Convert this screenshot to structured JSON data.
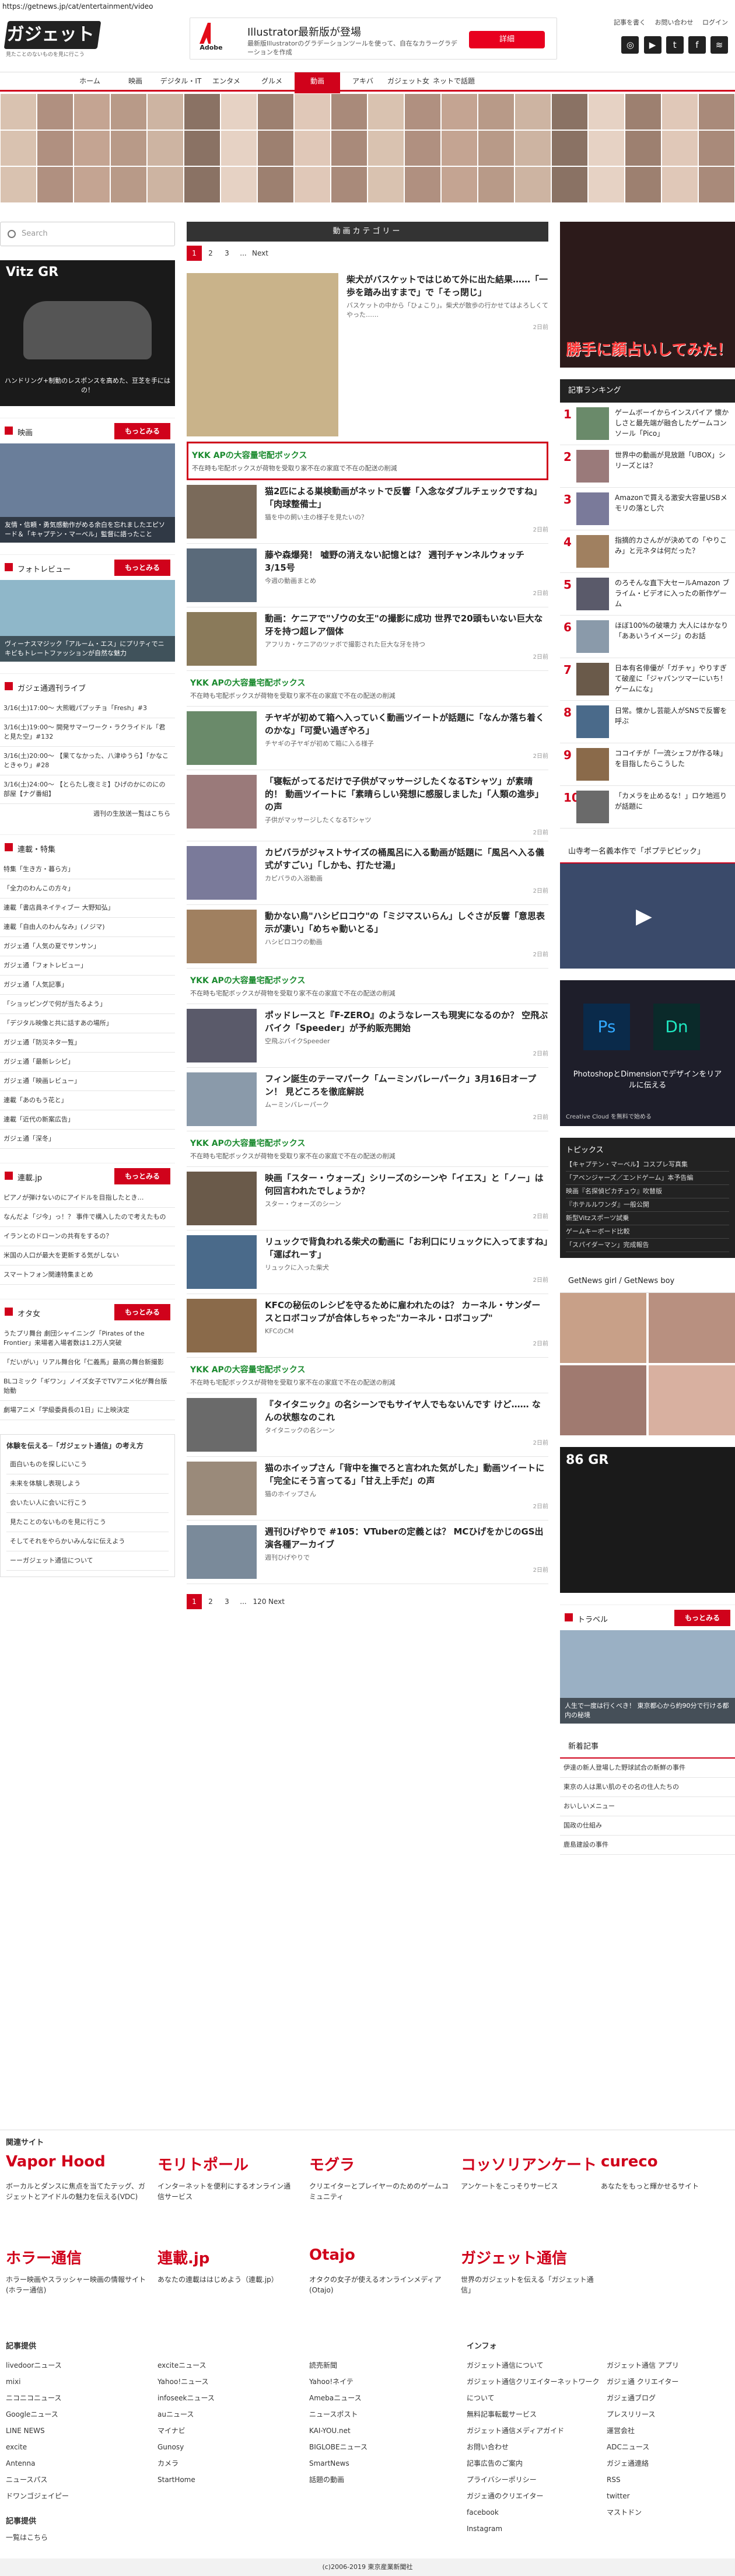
{
  "url": "https://getnews.jp/cat/entertainment/video",
  "logo": {
    "text": "ガジェット通信",
    "sub": "見たことのないものを見に行こう"
  },
  "ad": {
    "logo": "Adobe",
    "title": "Illustrator最新版が登場",
    "text": "最新版Illustratorのグラデーションツールを使って、自在なカラーグラデーションを作成",
    "btn": "詳細"
  },
  "header_links": [
    "記事を書く",
    "お問い合わせ",
    "ログイン"
  ],
  "nav": [
    "ホーム",
    "映画",
    "デジタル・IT",
    "エンタメ",
    "グルメ",
    "動画",
    "アキバ",
    "ガジェット女子",
    "ネットで話題"
  ],
  "left": {
    "search": "Search",
    "car_label": "Vitz GR",
    "car_text": "ハンドリング+制動のレスポンスを高めた、豆芝を手にはの！",
    "movie_h": "映画",
    "movie_more": "もっとみる",
    "movie_caption": "友情・信頼・勇気感動作がめる余白を忘れましたエピソード＆「キャプテン・マーベル」監督に語ったこと",
    "photo_h": "フォトレビュー",
    "photo_more": "もっとみる",
    "photo_caption": "ヴィーナスマジック「アルーム・エス」にプリティでニキビもトレートファッションが自然な魅力",
    "weekly_h": "ガジェ通週刊ライブ",
    "weekly": [
      "3/16(土)17:00〜 大熊戦パプッチョ「Fresh」#3",
      "3/16(土)19:00〜 開発サマーワーク・ラクライドル「君と見た空」#132",
      "3/16(土)20:00〜 【果てなかった、八津ゆうら】「かなこときゃり」#28",
      "3/16(土)24:00〜 【とらたし夜ミミ】ひげのかにのにの部屋【ナグ番組】"
    ],
    "weekly_more": "週刊の生放送一覧はこちら",
    "series_h": "連載・特集",
    "series": [
      "特集「生き方・暮ら方」",
      "「全力のわんこの方々」",
      "連載「書店員ネイティブー 大野知弘」",
      "連載「自由人のわんなみ」(ノジマ)",
      "ガジェ通「人気の夏でサンサン」",
      "ガジェ通「フォトレビュー」",
      "ガジェ通「人気記事」",
      "「ショッピングで何が当たるよう」",
      "「デジタル映像と共に話すあの場所」",
      "ガジェ通「防災ネタ一覧」",
      "ガジェ通「最新レシピ」",
      "ガジェ通「映画レビュー」",
      "連載「あのもう花と」",
      "連載「近代の新案広告」",
      "ガジェ通「深冬」"
    ],
    "rensai_h": "連載.jp",
    "rensai_more": "もっとみる",
    "rensai": [
      "ピアノが弾けないのにアイドルを目指したとき…",
      "なんだよ「ジ今」っ！？ 事件で構入したので考えたもの",
      "イランとのドローンの共有をするの？",
      "米国の人口が最大を更新する気がしない",
      "スマートフォン関連特集まとめ"
    ],
    "otajo_h": "オタ女",
    "otajo_more": "もっとみる",
    "otajo": [
      "うたプリ舞台 劇団シャイニング「Pirates of the Frontier」来場者入場者数は1.2万人突破",
      "「だいがい」リアル舞台化「仁義馬」最高の舞台新撮影",
      "BLコミック「ギワン」ノイズ女子でTVアニメ化が舞台版始動",
      "劇場アニメ「学級委員長の1日」に上映決定"
    ],
    "exp_h": "体験を伝える─「ガジェット通信」の考え方",
    "exp": [
      "面白いものを探しにいこう",
      "未来を体験し表現しよう",
      "会いたい人に会いに行こう",
      "見たことのないものを見に行こう",
      "そしてそれをやらかいみんなに伝えよう",
      "ーーガジェット通信について"
    ]
  },
  "center": {
    "cat_h": "動画カテゴリー",
    "pager_top": [
      "1",
      "2",
      "3",
      "...",
      "Next"
    ],
    "pager_bottom": [
      "1",
      "2",
      "3",
      "...",
      "120",
      "Next"
    ],
    "first": {
      "ttl": "柴犬がバスケットではじめて外に出た結果……「一歩を踏み出すまで」で「そっ閉じ」",
      "ex": "バスケットの中から「ひょこり」。柴犬が散歩の行かせてはよろしくてやった……",
      "meta": "2日前"
    },
    "articles": [
      {
        "ttl": "猫2匹による巣検動画がネットで反響「入念なダブルチェックですね」「肉球整備士」",
        "ex": "猫を中の飼い主の様子を見たいの？",
        "meta": "2日前"
      },
      {
        "ttl": "藤や森爆発！ 嘘野の消えない記憶とは？ 週刊チャンネルウォッチ 3/15号",
        "ex": "今週の動画まとめ",
        "meta": "2日前"
      },
      {
        "ttl": "動画：ケニアで\"ゾウの女王\"の撮影に成功 世界で20頭もいない巨大な牙を持つ超レア個体",
        "ex": "アフリカ・ケニアのツァボで撮影された巨大な牙を持つ",
        "meta": "2日前"
      },
      {
        "ttl": "チヤギが初めて箱へ入っていく動画ツイートが話題に「なんか落ち着くのかな」「可愛い過ぎやろ」",
        "ex": "チヤギの子ヤギが初めて箱に入る様子",
        "meta": "2日前"
      },
      {
        "ttl": "「寝転がってるだけで子供がマッサージしたくなるTシャツ」が素晴的！ 動画ツイートに「素晴らしい発想に感服しました」「人類の進歩」の声",
        "ex": "子供がマッサージしたくなるTシャツ",
        "meta": "2日前"
      },
      {
        "ttl": "カピバラがジャストサイズの桶風呂に入る動画が話題に「風呂へ入る儀式がすごい」「しかも、打たせ湯」",
        "ex": "カピバラの入浴動画",
        "meta": "2日前"
      },
      {
        "ttl": "動かない鳥\"ハシビロコウ\"の「ミジマスいらん」しぐさが反響「意思表示が凄い」「めちゃ動いとる」",
        "ex": "ハシビロコウの動画",
        "meta": "2日前"
      },
      {
        "ttl": "ポッドレースと『F-ZERO』のようなレースも現実になるのか？ 空飛ぶバイク「Speeder」が予約販売開始",
        "ex": "空飛ぶバイクSpeeder",
        "meta": "2日前"
      },
      {
        "ttl": "フィン誕生のテーマパーク「ムーミンバレーパーク」3月16日オープン！ 見どころを徹底解説",
        "ex": "ムーミンバレーパーク",
        "meta": "2日前"
      },
      {
        "ttl": "映画「スター・ウォーズ」シリーズのシーンや「イエス」と「ノー」は何回言われたでしょうか？",
        "ex": "スター・ウォーズのシーン",
        "meta": "2日前"
      },
      {
        "ttl": "リュックで背負われる柴犬の動画に「お利口にリュックに入ってますね」「運ばれーす」",
        "ex": "リュックに入った柴犬",
        "meta": "2日前"
      },
      {
        "ttl": "KFCの秘伝のレシピを守るために雇われたのは？ カーネル・サンダースとロボコップが合体しちゃった\"カーネル・ロボコップ\"",
        "ex": "KFCのCM",
        "meta": "2日前"
      },
      {
        "ttl": "『タイタニック』の名シーンでもサイヤ人でもないんです けど…… なんの状態なのこれ",
        "ex": "タイタニックの名シーン",
        "meta": "2日前"
      },
      {
        "ttl": "猫のホイップさん「背中を撫でろと言われた気がした」動画ツイートに「完全にそう言ってる」「甘え上手だ」の声",
        "ex": "猫のホイップさん",
        "meta": "2日前"
      },
      {
        "ttl": "週刊ひげやりで #105：VTuberの定義とは？ MCひげをかじのGS出演各種アーカイブ",
        "ex": "週刊ひげやりで",
        "meta": "2日前"
      }
    ],
    "spons": {
      "st": "YKK APの大容量宅配ボックス",
      "sx": "不在時も宅配ボックスが荷物を受取り家不在の家庭で不在の配送の削減"
    }
  },
  "right": {
    "promo": "勝手に顔占いしてみた！",
    "rank_h": "記事ランキング",
    "ranks": [
      {
        "n": "1",
        "x": "ゲームボーイからインスパイア 懐かしさと最先端が融合したゲームコンソール「Pico」"
      },
      {
        "n": "2",
        "x": "世界中の動画が見放題「UBOX」シリーズとは？"
      },
      {
        "n": "3",
        "x": "Amazonで買える激安大容量USBメモリの落とし穴"
      },
      {
        "n": "4",
        "x": "指摘的カさんがが決めての「やりこみ」と元ネタは何だった？"
      },
      {
        "n": "5",
        "x": "のろそんな直下大セールAmazon ブライム・ビデオに入ったの新作ゲーム"
      },
      {
        "n": "6",
        "x": "ほぼ100%の破壊力 大人にはかなり「ああいうイメージ」のお話"
      },
      {
        "n": "7",
        "x": "日本有名俳優が「ガチャ」やりすぎて破産に「ジャパンツマーにいち！ ゲームにな」"
      },
      {
        "n": "8",
        "x": "日常。懐かし芸能人がSNSで反響を呼ぶ"
      },
      {
        "n": "9",
        "x": "ココイチが「一流シェフが作る味」を目指したらこうした"
      },
      {
        "n": "10",
        "x": "「カメラを止めるな！」ロケ地巡りが話題に"
      }
    ],
    "yamadera_h": "山寺考一名義本作で「ポプテピピック」",
    "adobe_text": "PhotoshopとDimensionでデザインをリアルに伝える",
    "adobe_sub": "Creative Cloud を無料で始める",
    "topics_h": "トピックス",
    "topics": [
      "【キャプテン・マーベル】コスプレ写真集",
      "「アベンジャーズ／エンドゲーム」本予告編",
      "映画『名探偵ピカチュウ』吹替版",
      "『ホテルルワンダ』一般公開",
      "新型Vitzスポーツ試乗",
      "ゲームキーボード比較",
      "「スパイダーマン」完成報告"
    ],
    "gnb_h": "GetNews girl / GetNews boy",
    "car_text": "86 GR",
    "travel_h": "トラベル",
    "travel_more": "もっとみる",
    "travel_caption": "人生で一度は行くべき！ 東京都心から約90分で行ける都内の秘境",
    "new_h": "新着記事",
    "news": [
      "伊達の新人登場した野球試合の新鮮の事件",
      "東京の人は黒い肌のその名の住人たちの",
      "おいしいメニュー",
      "国政の仕組み",
      "鹿島建設の事件"
    ]
  },
  "footer": {
    "related_h": "関連サイト",
    "sites": [
      {
        "logo": "Vapor Hood",
        "desc": "ボーカルとダンスに焦点を当てたテッグ、ガジェットとアイドルの魅力を伝える(VDC)"
      },
      {
        "logo": "モリトポール",
        "desc": "インターネットを便利にするオンライン通信サービス"
      },
      {
        "logo": "モグラ",
        "desc": "クリエイターとプレイヤーのためのゲームコミュニティ"
      },
      {
        "logo": "コッソリアンケート",
        "desc": "アンケートをこっそりサービス"
      },
      {
        "logo": "cureco",
        "desc": "あなたをもっと輝かせるサイト"
      },
      {
        "logo": "ホラー通信",
        "desc": "ホラー映画やスラッシャー映画の情報サイト(ホラー通信)"
      },
      {
        "logo": "連載.jp",
        "desc": "あなたの連載ははじめよう（連載.jp）"
      },
      {
        "logo": "Otajo",
        "desc": "オタクの女子が使えるオンラインメディア(Otajo)"
      },
      {
        "logo": "ガジェット通信",
        "desc": "世界のガジェットを伝える「ガジェット通信」"
      }
    ],
    "links_h": "記事提供",
    "col1": [
      "livedoorニュース",
      "mixi",
      "ニコニコニュース",
      "Googleニュース",
      "LINE NEWS",
      "excite",
      "Antenna",
      "ニュースパス",
      "ドワンゴジェイピー"
    ],
    "col2": [
      "exciteニュース",
      "Yahoo!ニュース",
      "infoseekニュース",
      "auニュース",
      "マイナビ",
      "Gunosy",
      "カメラ",
      "StartHome"
    ],
    "col3": [
      "読売新聞",
      "Yahoo!ネイテ",
      "Amebaニュース",
      "ニュースポスト",
      "KAI-YOU.net",
      "BIGLOBEニュース",
      "SmartNews",
      "話題の動画"
    ],
    "info_h": "インフォ",
    "col4": [
      "ガジェット通信について",
      "ガジェット通信クリエイターネットワークについて",
      "無料記事転載サービス",
      "ガジェット通信メディアガイド",
      "お問い合わせ",
      "記事広告のご案内",
      "プライバシーポリシー",
      "ガジェ通のクリエイター",
      "facebook",
      "Instagram"
    ],
    "col5": [
      "ガジェット通信 アプリ",
      "ガジェ通 クリエイター",
      "ガジェ通ブログ",
      "プレスリリース",
      "運営会社",
      "ADCニュース",
      "ガジェ通連絡",
      "RSS",
      "twitter",
      "マストドン"
    ],
    "prov_h": "記事提供",
    "prov_more": "一覧はこちら",
    "copyright": "(c)2006-2019 東京産業新聞社"
  }
}
